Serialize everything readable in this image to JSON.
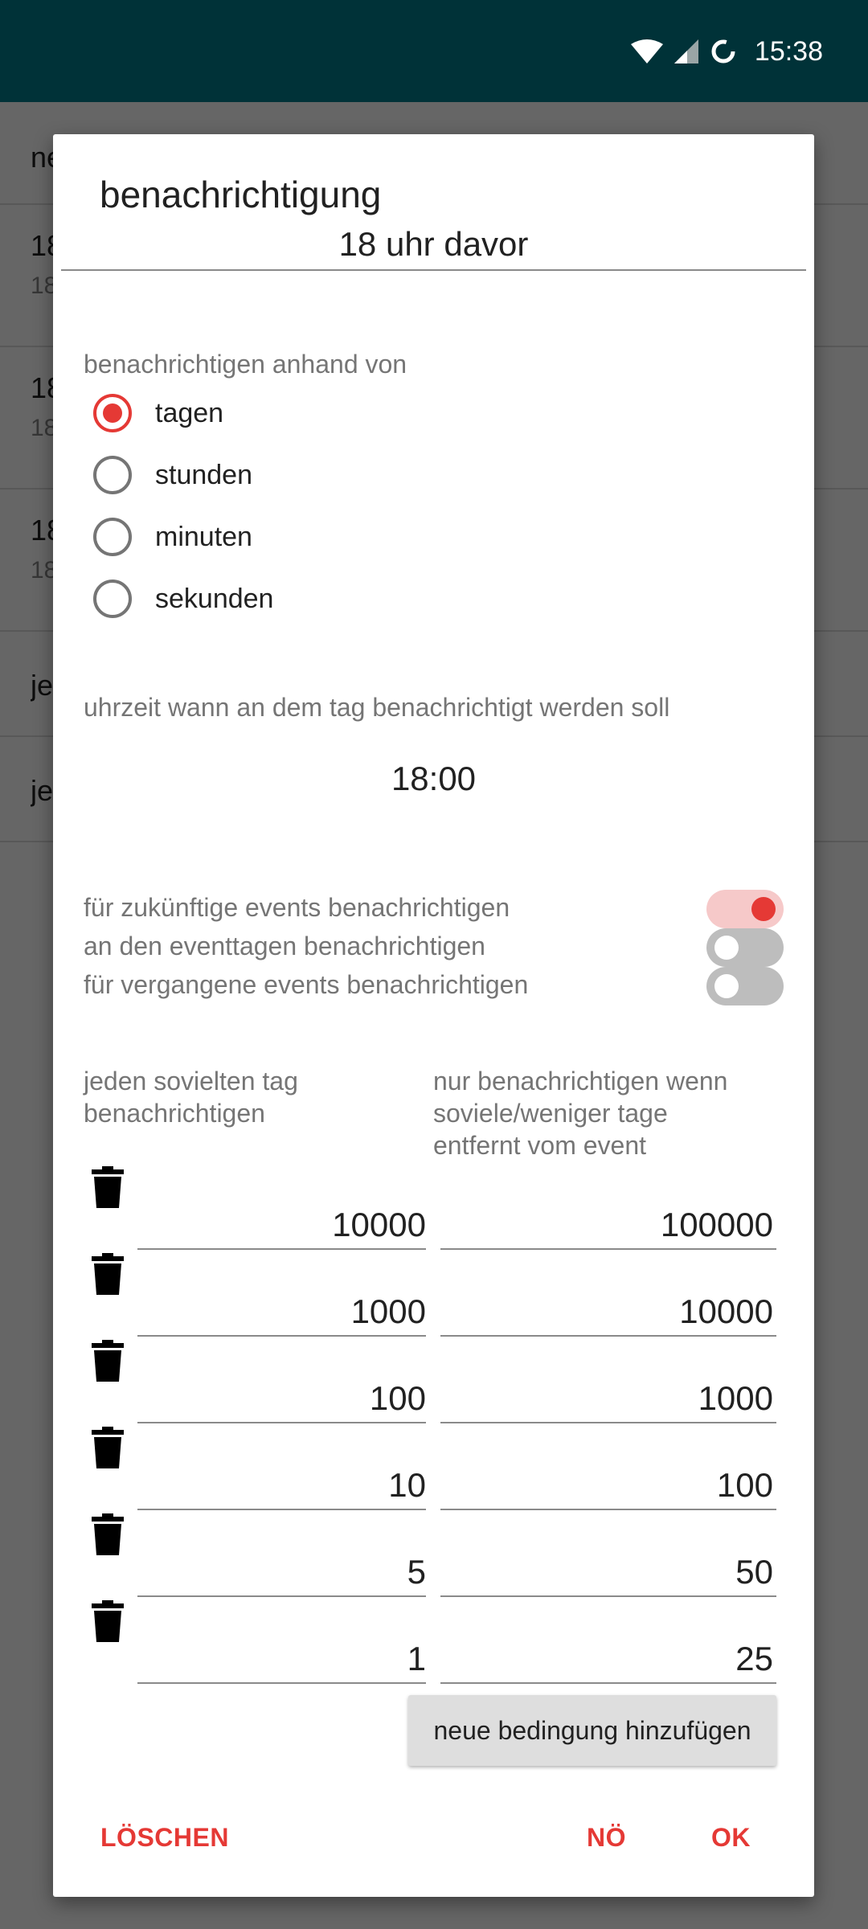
{
  "status_bar": {
    "time": "15:38",
    "icons": [
      "wifi-icon",
      "signal-icon",
      "sync-icon"
    ]
  },
  "background_list": {
    "rows": [
      {
        "line1": "ne",
        "line2": ""
      },
      {
        "line1": "18",
        "line2": "18"
      },
      {
        "line1": "18",
        "line2": "18"
      },
      {
        "line1": "18",
        "line2": "18"
      },
      {
        "line1": "je",
        "line2": ""
      },
      {
        "line1": "je",
        "line2": ""
      }
    ]
  },
  "dialog": {
    "title": "benachrichtigung",
    "name_value": "18 uhr davor",
    "unit_label": "benachrichtigen anhand von",
    "units": [
      {
        "label": "tagen",
        "selected": true
      },
      {
        "label": "stunden",
        "selected": false
      },
      {
        "label": "minuten",
        "selected": false
      },
      {
        "label": "sekunden",
        "selected": false
      }
    ],
    "time_label": "uhrzeit wann an dem tag benachrichtigt werden soll",
    "time_value": "18:00",
    "switches": [
      {
        "label": "für zukünftige events benachrichtigen",
        "on": true
      },
      {
        "label": "an den eventtagen benachrichtigen",
        "on": false
      },
      {
        "label": "für vergangene events benachrichtigen",
        "on": false
      }
    ],
    "col_every_line1": "jeden sovielten tag",
    "col_every_line2": "benachrichtigen",
    "col_only_line1": "nur benachrichtigen wenn",
    "col_only_line2": "soviele/weniger tage",
    "col_only_line3": "entfernt vom event",
    "conditions": [
      {
        "every": "10000",
        "within": "100000"
      },
      {
        "every": "1000",
        "within": "10000"
      },
      {
        "every": "100",
        "within": "1000"
      },
      {
        "every": "10",
        "within": "100"
      },
      {
        "every": "5",
        "within": "50"
      },
      {
        "every": "1",
        "within": "25"
      }
    ],
    "add_button": "neue bedingung hinzufügen",
    "delete_action": "LÖSCHEN",
    "cancel_action": "NÖ",
    "ok_action": "OK",
    "accent_color": "#e53935"
  }
}
